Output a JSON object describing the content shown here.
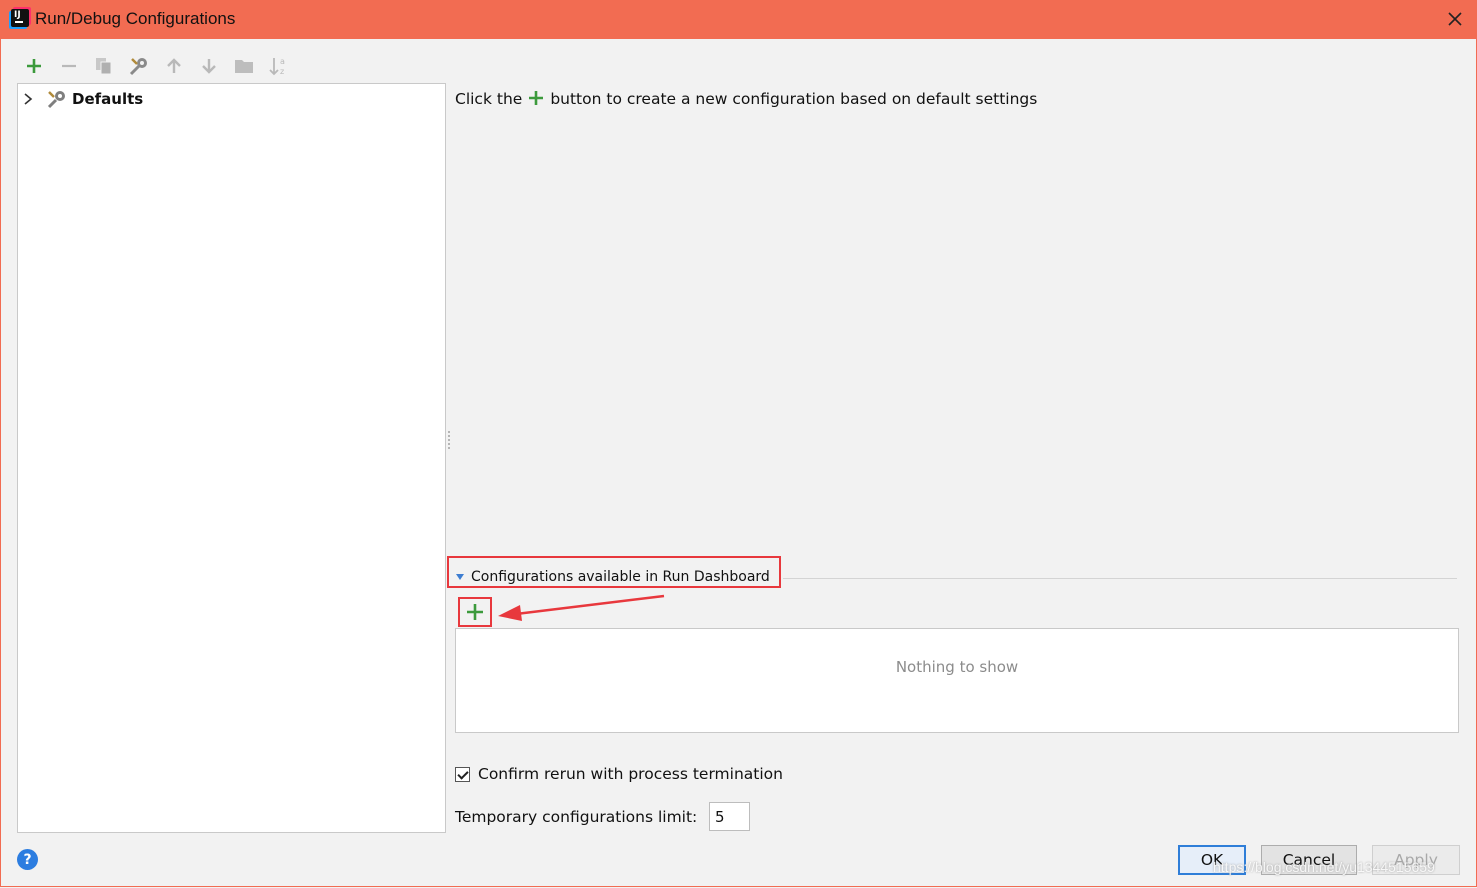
{
  "window": {
    "title": "Run/Debug Configurations"
  },
  "toolbar": {
    "icons": [
      "add-icon",
      "remove-icon",
      "copy-icon",
      "edit-defaults-icon",
      "move-up-icon",
      "move-down-icon",
      "folder-icon",
      "sort-icon"
    ]
  },
  "tree": {
    "items": [
      {
        "label": "Defaults",
        "icon": "wrench-gear-icon",
        "expanded": false
      }
    ]
  },
  "main": {
    "hint_prefix": "Click the",
    "hint_suffix": "button to create a new configuration based on default settings"
  },
  "dashboard": {
    "section_label": "Configurations available in Run Dashboard",
    "empty_text": "Nothing to show"
  },
  "options": {
    "confirm_rerun_label": "Confirm rerun with process termination",
    "confirm_rerun_checked": true,
    "temp_limit_label": "Temporary configurations limit:",
    "temp_limit_value": "5"
  },
  "buttons": {
    "ok": "OK",
    "cancel": "Cancel",
    "apply": "Apply"
  },
  "watermark": "https://blog.csdn.net/yu1344515659",
  "colors": {
    "titlebar": "#f26c52",
    "accent_blue": "#2f7ed8",
    "add_green": "#3c9a3c",
    "annotation_red": "#e8383d"
  }
}
